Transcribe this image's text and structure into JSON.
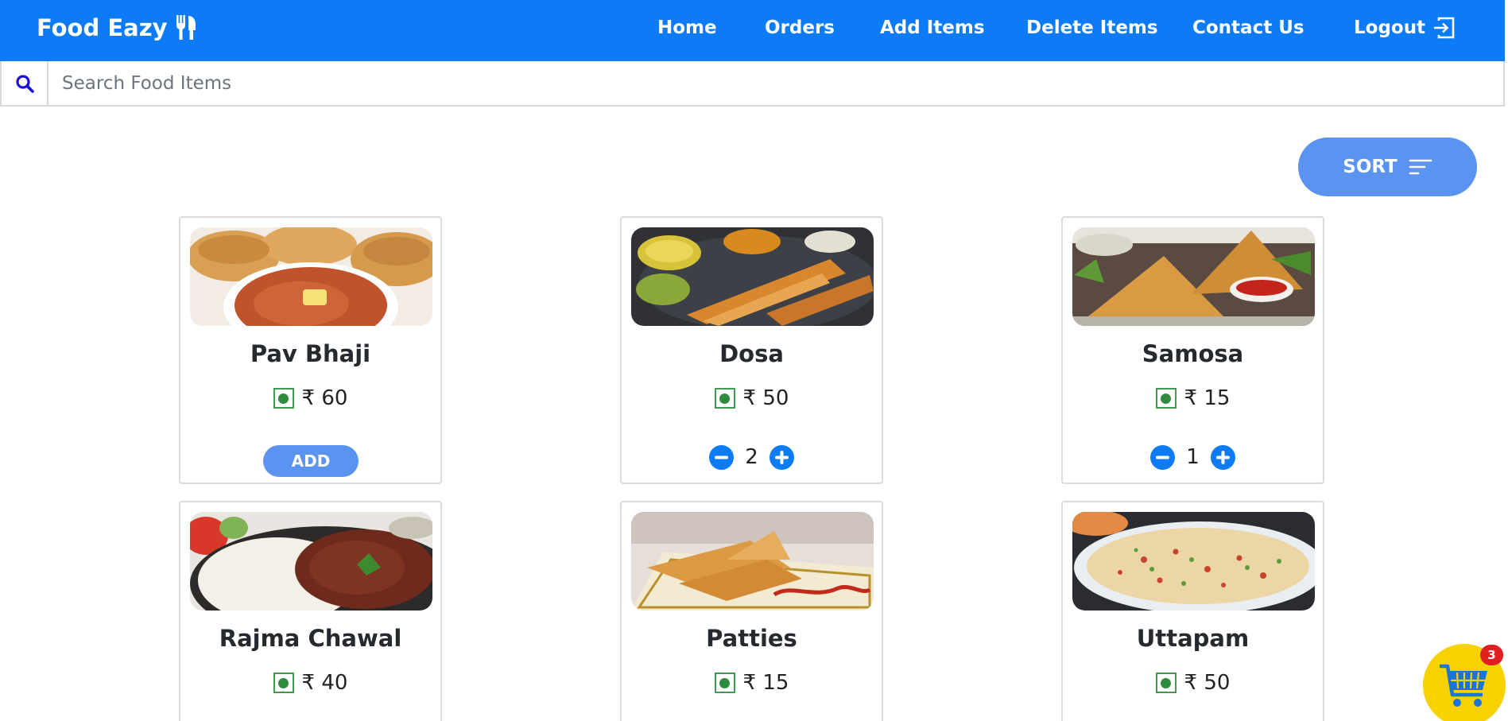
{
  "brand": {
    "name": "Food Eazy",
    "icon": "utensils-icon"
  },
  "nav": {
    "home": "Home",
    "orders": "Orders",
    "add_items": "Add Items",
    "delete_items": "Delete Items",
    "contact_us": "Contact Us",
    "logout": "Logout"
  },
  "search": {
    "placeholder": "Search Food Items",
    "value": "",
    "icon": "search-icon"
  },
  "sort": {
    "label": "SORT",
    "icon": "sort-lines-icon"
  },
  "currency": "₹",
  "items": [
    {
      "name": "Pav Bhaji",
      "price": "₹ 60",
      "veg": true,
      "action": "ADD"
    },
    {
      "name": "Dosa",
      "price": "₹ 50",
      "veg": true,
      "quantity": "2"
    },
    {
      "name": "Samosa",
      "price": "₹ 15",
      "veg": true,
      "quantity": "1"
    },
    {
      "name": "Rajma Chawal",
      "price": "₹ 40",
      "veg": true
    },
    {
      "name": "Patties",
      "price": "₹ 15",
      "veg": true
    },
    {
      "name": "Uttapam",
      "price": "₹ 50",
      "veg": true
    }
  ],
  "cart": {
    "count": "3",
    "icon": "shopping-cart-icon"
  },
  "colors": {
    "primary": "#0d7bf6",
    "button": "#5b93f0",
    "veg": "#2f8c3f",
    "cart": "#f7d100",
    "badge": "#e02020"
  }
}
